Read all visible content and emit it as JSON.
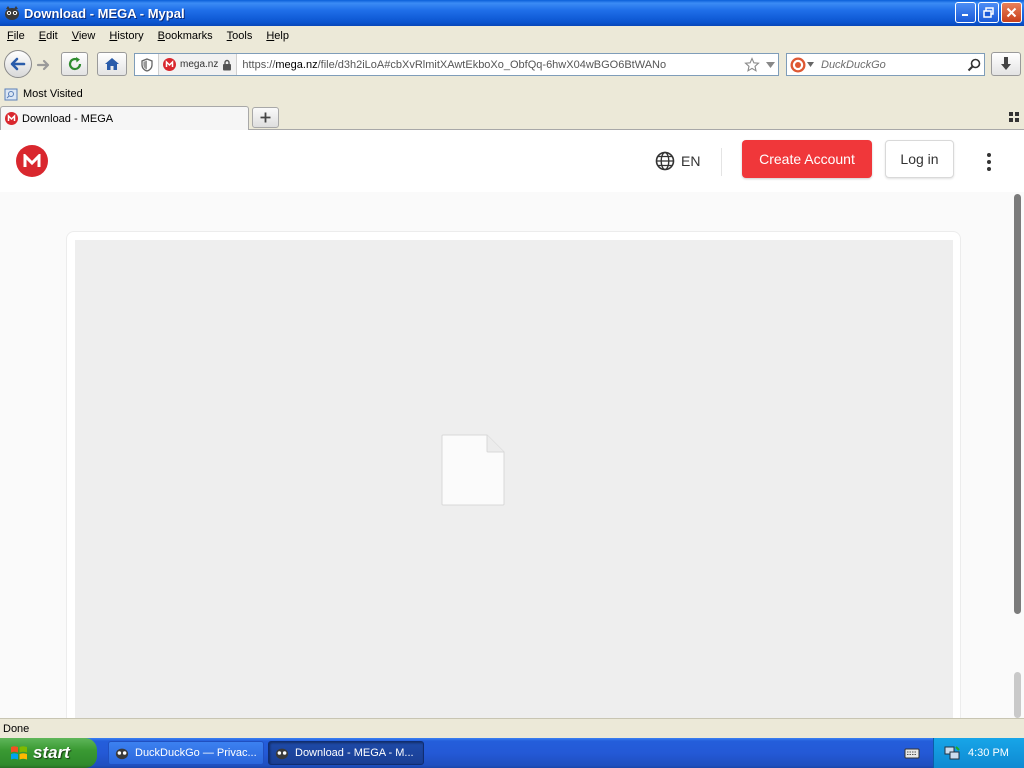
{
  "window": {
    "title": "Download - MEGA - Mypal"
  },
  "menu": {
    "items": [
      {
        "label": "File",
        "accel": "F",
        "rest": "ile"
      },
      {
        "label": "Edit",
        "accel": "E",
        "rest": "dit"
      },
      {
        "label": "View",
        "accel": "V",
        "rest": "iew"
      },
      {
        "label": "History",
        "accel": "H",
        "rest": "istory"
      },
      {
        "label": "Bookmarks",
        "accel": "B",
        "rest": "ookmarks"
      },
      {
        "label": "Tools",
        "accel": "T",
        "rest": "ools"
      },
      {
        "label": "Help",
        "accel": "H",
        "rest": "elp"
      }
    ]
  },
  "urlbar": {
    "site_label": "mega.nz",
    "url_prefix": "https://",
    "url_domain": "mega.nz",
    "url_path": "/file/d3h2iLoA#cbXvRlmitXAwtEkboXo_ObfQq-6hwX04wBGO6BtWANo"
  },
  "search": {
    "placeholder": "DuckDuckGo"
  },
  "bookmarks": {
    "most_visited": "Most Visited"
  },
  "tab": {
    "title": "Download - MEGA"
  },
  "mega": {
    "language": "EN",
    "create_account": "Create Account",
    "login": "Log in"
  },
  "statusbar": {
    "text": "Done"
  },
  "taskbar": {
    "start_label": "start",
    "tasks": [
      {
        "label": "DuckDuckGo — Privac..."
      },
      {
        "label": "Download - MEGA - M..."
      }
    ],
    "clock": "4:30 PM"
  },
  "colors": {
    "mega_red": "#d9272e",
    "create_account_bg": "#f0373a",
    "xp_blue": "#245edb",
    "start_green": "#3a9a33"
  }
}
